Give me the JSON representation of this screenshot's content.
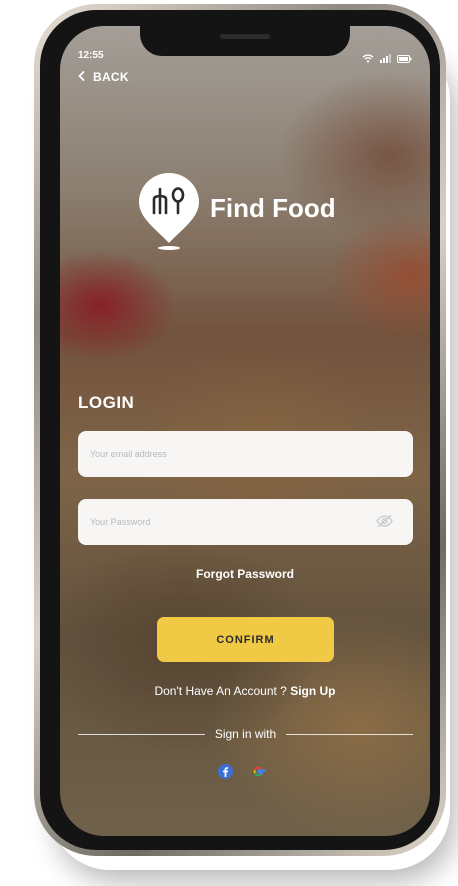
{
  "status_bar": {
    "time": "12:55",
    "icons": [
      "wifi-icon",
      "signal-icon",
      "battery-icon"
    ]
  },
  "nav": {
    "back_label": "BACK",
    "back_icon": "chevron-left-icon"
  },
  "brand": {
    "name": "Find Food",
    "logo_icon": "fork-spoon-pin-icon"
  },
  "login": {
    "title": "LOGIN",
    "email_placeholder": "Your email address",
    "password_placeholder": "Your Password",
    "password_toggle_icon": "eye-off-icon",
    "forgot_label": "Forgot Password",
    "confirm_label": "CONFIRM"
  },
  "signup": {
    "prompt": "Don't Have An Account ?",
    "link_label": "Sign Up"
  },
  "social": {
    "divider_label": "Sign in with",
    "providers": [
      "facebook-icon",
      "google-icon"
    ]
  },
  "colors": {
    "accent": "#f1ca45",
    "facebook": "#3b6fd8",
    "field_bg": "#f7f6f5"
  }
}
